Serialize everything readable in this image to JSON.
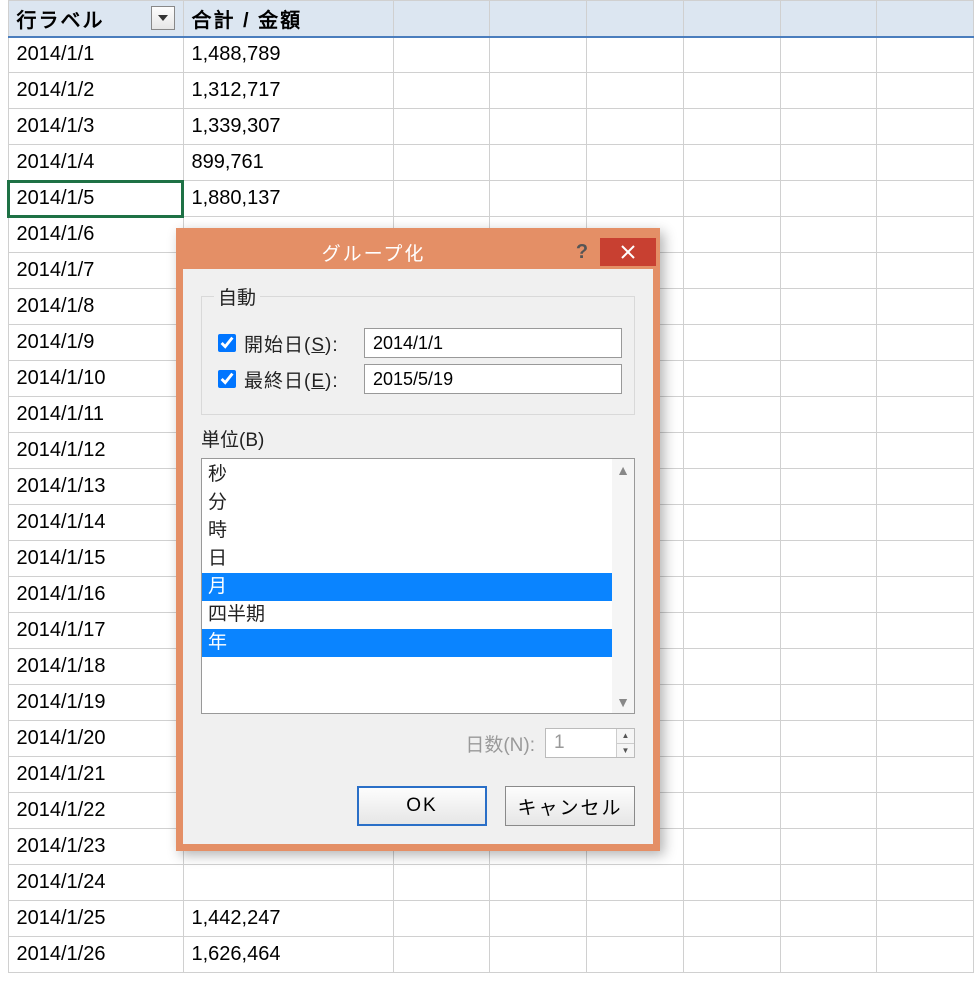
{
  "headers": {
    "row_label": "行ラベル",
    "sum_amount": "合計 / 金額"
  },
  "rows": [
    {
      "date": "2014/1/1",
      "value": "1,488,789"
    },
    {
      "date": "2014/1/2",
      "value": "1,312,717"
    },
    {
      "date": "2014/1/3",
      "value": "1,339,307"
    },
    {
      "date": "2014/1/4",
      "value": "899,761"
    },
    {
      "date": "2014/1/5",
      "value": "1,880,137",
      "selected": true
    },
    {
      "date": "2014/1/6",
      "value": ""
    },
    {
      "date": "2014/1/7",
      "value": ""
    },
    {
      "date": "2014/1/8",
      "value": ""
    },
    {
      "date": "2014/1/9",
      "value": ""
    },
    {
      "date": "2014/1/10",
      "value": ""
    },
    {
      "date": "2014/1/11",
      "value": ""
    },
    {
      "date": "2014/1/12",
      "value": ""
    },
    {
      "date": "2014/1/13",
      "value": ""
    },
    {
      "date": "2014/1/14",
      "value": ""
    },
    {
      "date": "2014/1/15",
      "value": ""
    },
    {
      "date": "2014/1/16",
      "value": ""
    },
    {
      "date": "2014/1/17",
      "value": ""
    },
    {
      "date": "2014/1/18",
      "value": ""
    },
    {
      "date": "2014/1/19",
      "value": ""
    },
    {
      "date": "2014/1/20",
      "value": ""
    },
    {
      "date": "2014/1/21",
      "value": ""
    },
    {
      "date": "2014/1/22",
      "value": ""
    },
    {
      "date": "2014/1/23",
      "value": ""
    },
    {
      "date": "2014/1/24",
      "value": ""
    },
    {
      "date": "2014/1/25",
      "value": "1,442,247"
    },
    {
      "date": "2014/1/26",
      "value": "1,626,464"
    }
  ],
  "dialog": {
    "title": "グループ化",
    "auto_group": "自動",
    "start_label_pre": "開始日(",
    "start_key": "S",
    "start_label_post": "):",
    "start_value": "2014/1/1",
    "end_label_pre": "最終日(",
    "end_key": "E",
    "end_label_post": "):",
    "end_value": "2015/5/19",
    "unit_label_pre": "単位(",
    "unit_key": "B",
    "unit_label_post": ")",
    "units": [
      {
        "label": "秒",
        "selected": false
      },
      {
        "label": "分",
        "selected": false
      },
      {
        "label": "時",
        "selected": false
      },
      {
        "label": "日",
        "selected": false
      },
      {
        "label": "月",
        "selected": true
      },
      {
        "label": "四半期",
        "selected": false
      },
      {
        "label": "年",
        "selected": true
      }
    ],
    "days_label": "日数(N):",
    "days_value": "1",
    "ok": "OK",
    "cancel": "キャンセル"
  }
}
